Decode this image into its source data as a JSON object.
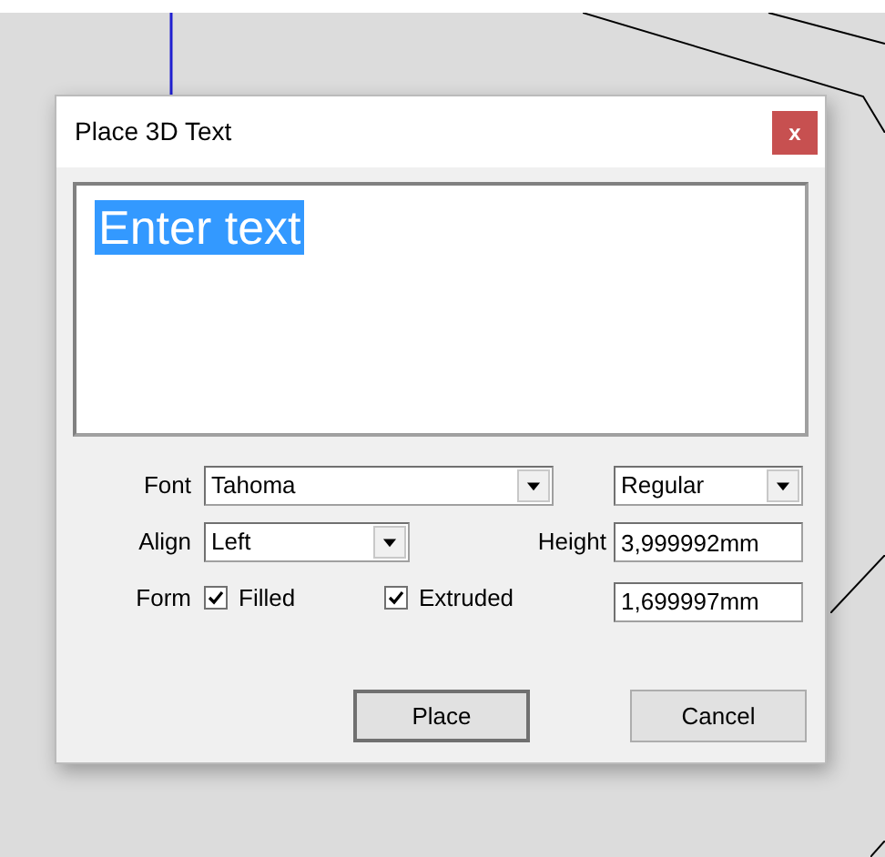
{
  "window": {
    "title": "Place 3D Text",
    "close": "x"
  },
  "text_area": {
    "value": "Enter text",
    "selected": true
  },
  "font": {
    "label": "Font",
    "value": "Tahoma"
  },
  "style": {
    "value": "Regular"
  },
  "align": {
    "label": "Align",
    "value": "Left"
  },
  "height": {
    "label": "Height",
    "value": "3,999992mm"
  },
  "form": {
    "label": "Form",
    "options": [
      {
        "label": "Filled",
        "checked": true
      },
      {
        "label": "Extruded",
        "checked": true
      }
    ],
    "depth": "1,699997mm"
  },
  "buttons": [
    {
      "label": "Place",
      "default": true
    },
    {
      "label": "Cancel",
      "default": false
    }
  ]
}
